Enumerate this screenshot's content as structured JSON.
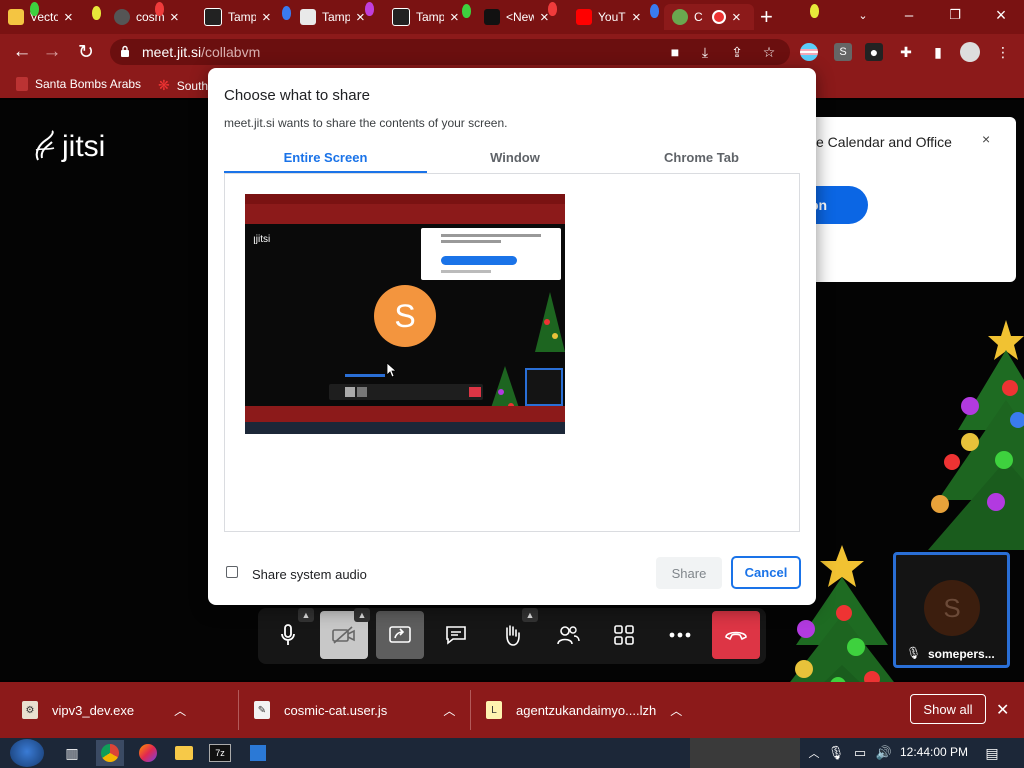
{
  "browser": {
    "tabs": [
      {
        "title": "Vecto"
      },
      {
        "title": "cosm"
      },
      {
        "title": "Tamp"
      },
      {
        "title": "Tamp"
      },
      {
        "title": "Tamp"
      },
      {
        "title": "<New"
      },
      {
        "title": "YouT"
      },
      {
        "title": "C"
      }
    ],
    "url": {
      "host": "meet.jit.si",
      "path": "/collabvm"
    },
    "bookmarks": [
      {
        "label": "Santa Bombs Arabs"
      },
      {
        "label": "South"
      }
    ]
  },
  "meeting": {
    "logo_text": "jitsi",
    "extension_banner": {
      "text": "e Calendar and Office",
      "button_label": "on",
      "close_glyph": "×"
    },
    "participant": {
      "name": "somepers...",
      "initial": "S"
    }
  },
  "share_dialog": {
    "title": "Choose what to share",
    "subtitle": "meet.jit.si wants to share the contents of your screen.",
    "tabs": [
      "Entire Screen",
      "Window",
      "Chrome Tab"
    ],
    "selected_tab": "Entire Screen",
    "share_audio_label": "Share system audio",
    "share_audio_checked": false,
    "share_label": "Share",
    "cancel_label": "Cancel",
    "preview_avatar_initial": "S"
  },
  "downloads": {
    "items": [
      {
        "name": "vipv3_dev.exe"
      },
      {
        "name": "cosmic-cat.user.js"
      },
      {
        "name": "agentzukandaimyo....lzh"
      }
    ],
    "show_all_label": "Show all"
  },
  "taskbar": {
    "clock": "12:44:00 PM"
  },
  "colors": {
    "chrome_red": "#8c1a1a",
    "accent_blue": "#1a73e8",
    "hangup_red": "#dd3545",
    "avatar_orange": "#f3953e"
  }
}
